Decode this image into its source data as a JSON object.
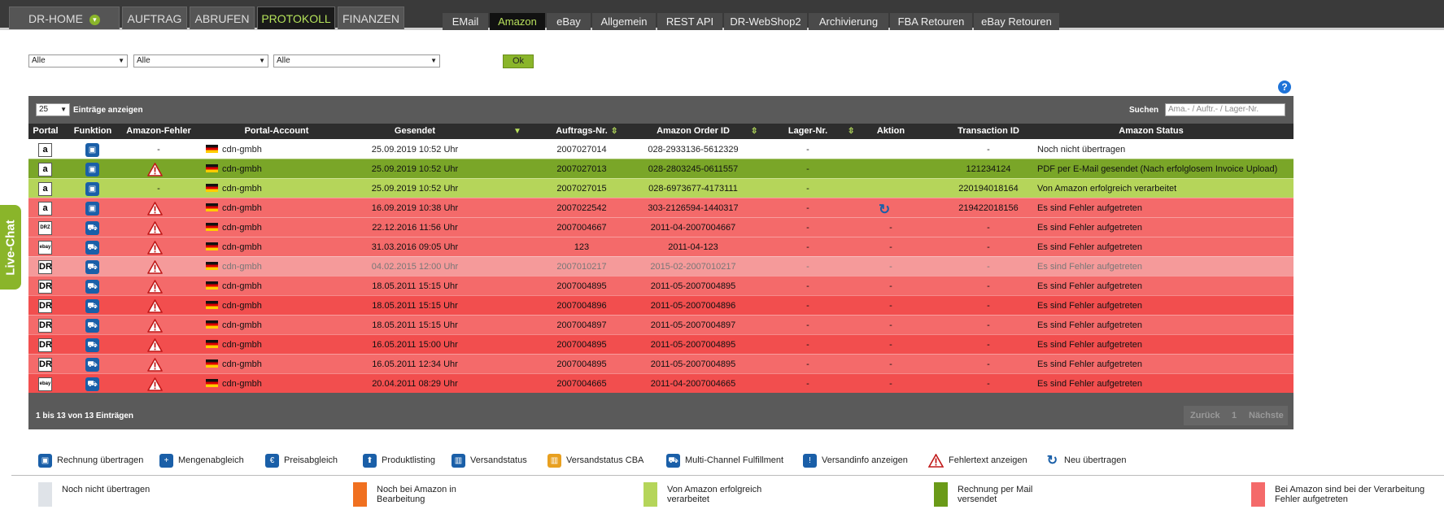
{
  "main_tabs": [
    {
      "label": "DR-HOME",
      "active": false
    },
    {
      "label": "AUFTRAG",
      "active": false
    },
    {
      "label": "ABRUFEN",
      "active": false
    },
    {
      "label": "PROTOKOLL",
      "active": true
    },
    {
      "label": "FINANZEN",
      "active": false
    }
  ],
  "sub_tabs": [
    {
      "label": "EMail",
      "active": false
    },
    {
      "label": "Amazon",
      "active": true
    },
    {
      "label": "eBay",
      "active": false
    },
    {
      "label": "Allgemein",
      "active": false
    },
    {
      "label": "REST API",
      "active": false
    },
    {
      "label": "DR-WebShop2",
      "active": false
    },
    {
      "label": "Archivierung",
      "active": false
    },
    {
      "label": "FBA Retouren",
      "active": false
    },
    {
      "label": "eBay Retouren",
      "active": false
    }
  ],
  "filters": {
    "select1": "Alle",
    "select2": "Alle",
    "select3": "Alle",
    "ok_label": "Ok"
  },
  "help_icon": "question-icon",
  "table": {
    "length_value": "25",
    "length_label": "Einträge anzeigen",
    "search_label": "Suchen",
    "search_placeholder": "Ama.- / Auftr.- / Lager-Nr.",
    "headers": [
      "Portal",
      "Funktion",
      "Amazon-Fehler",
      "Portal-Account",
      "Gesendet",
      "Auftrags-Nr.",
      "Amazon Order ID",
      "Lager-Nr.",
      "Aktion",
      "Transaction ID",
      "Amazon Status"
    ],
    "rows": [
      {
        "portal": "a",
        "portal_icon": "amazon-icon",
        "function_icon": "invoice-icon",
        "error": "-",
        "error_icon": false,
        "account": "cdn-gmbh",
        "sent": "25.09.2019 10:52 Uhr",
        "order_no": "2007027014",
        "amazon_order_id": "028-2933136-5612329",
        "storage_no": "-",
        "action": "",
        "action_icon": false,
        "transaction_id": "-",
        "status": "Noch nicht übertragen",
        "color": "#ffffff",
        "text_color": "#222"
      },
      {
        "portal": "a",
        "portal_icon": "amazon-icon",
        "function_icon": "invoice-icon",
        "error": "",
        "error_icon": true,
        "account": "cdn-gmbh",
        "sent": "25.09.2019 10:52 Uhr",
        "order_no": "2007027013",
        "amazon_order_id": "028-2803245-0611557",
        "storage_no": "-",
        "action": "",
        "action_icon": false,
        "transaction_id": "121234124",
        "status": "PDF per E-Mail gesendet (Nach erfolglosem Invoice Upload)",
        "color": "#7aa628",
        "text_color": "#111"
      },
      {
        "portal": "a",
        "portal_icon": "amazon-icon",
        "function_icon": "invoice-icon",
        "error": "-",
        "error_icon": false,
        "account": "cdn-gmbh",
        "sent": "25.09.2019 10:52 Uhr",
        "order_no": "2007027015",
        "amazon_order_id": "028-6973677-4173111",
        "storage_no": "-",
        "action": "",
        "action_icon": false,
        "transaction_id": "220194018164",
        "status": "Von Amazon erfolgreich verarbeitet",
        "color": "#b5d55a",
        "text_color": "#111"
      },
      {
        "portal": "a",
        "portal_icon": "amazon-icon",
        "function_icon": "invoice-icon",
        "error": "",
        "error_icon": true,
        "account": "cdn-gmbh",
        "sent": "16.09.2019 10:38 Uhr",
        "order_no": "2007022542",
        "amazon_order_id": "303-2126594-1440317",
        "storage_no": "-",
        "action": "",
        "action_icon": true,
        "transaction_id": "219422018156",
        "status": "Es sind Fehler aufgetreten",
        "color": "#f46a6a",
        "text_color": "#111"
      },
      {
        "portal": "DRZ",
        "portal_icon": "drz-icon",
        "function_icon": "truck-icon",
        "error": "",
        "error_icon": true,
        "account": "cdn-gmbh",
        "sent": "22.12.2016 11:56 Uhr",
        "order_no": "2007004667",
        "amazon_order_id": "2011-04-2007004667",
        "storage_no": "-",
        "action": "-",
        "action_icon": false,
        "transaction_id": "-",
        "status": "Es sind Fehler aufgetreten",
        "color": "#f46a6a",
        "text_color": "#111"
      },
      {
        "portal": "ebay",
        "portal_icon": "ebay-icon",
        "function_icon": "truck-icon",
        "error": "",
        "error_icon": true,
        "account": "cdn-gmbh",
        "sent": "31.03.2016 09:05 Uhr",
        "order_no": "123",
        "amazon_order_id": "2011-04-123",
        "storage_no": "-",
        "action": "-",
        "action_icon": false,
        "transaction_id": "-",
        "status": "Es sind Fehler aufgetreten",
        "color": "#f46a6a",
        "text_color": "#111"
      },
      {
        "portal": "DR",
        "portal_icon": "dr-icon",
        "function_icon": "truck-icon",
        "error": "",
        "error_icon": true,
        "account": "cdn-gmbh",
        "sent": "04.02.2015 12:00 Uhr",
        "order_no": "2007010217",
        "amazon_order_id": "2015-02-2007010217",
        "storage_no": "-",
        "action": "-",
        "action_icon": false,
        "transaction_id": "-",
        "status": "Es sind Fehler aufgetreten",
        "color": "#f59a9a",
        "text_color": "#777"
      },
      {
        "portal": "DR",
        "portal_icon": "dr-icon",
        "function_icon": "truck-icon",
        "error": "",
        "error_icon": true,
        "account": "cdn-gmbh",
        "sent": "18.05.2011 15:15 Uhr",
        "order_no": "2007004895",
        "amazon_order_id": "2011-05-2007004895",
        "storage_no": "-",
        "action": "-",
        "action_icon": false,
        "transaction_id": "-",
        "status": "Es sind Fehler aufgetreten",
        "color": "#f46a6a",
        "text_color": "#111"
      },
      {
        "portal": "DR",
        "portal_icon": "dr-icon",
        "function_icon": "truck-icon",
        "error": "",
        "error_icon": true,
        "account": "cdn-gmbh",
        "sent": "18.05.2011 15:15 Uhr",
        "order_no": "2007004896",
        "amazon_order_id": "2011-05-2007004896",
        "storage_no": "-",
        "action": "-",
        "action_icon": false,
        "transaction_id": "-",
        "status": "Es sind Fehler aufgetreten",
        "color": "#f24e4e",
        "text_color": "#111"
      },
      {
        "portal": "DR",
        "portal_icon": "dr-icon",
        "function_icon": "truck-icon",
        "error": "",
        "error_icon": true,
        "account": "cdn-gmbh",
        "sent": "18.05.2011 15:15 Uhr",
        "order_no": "2007004897",
        "amazon_order_id": "2011-05-2007004897",
        "storage_no": "-",
        "action": "-",
        "action_icon": false,
        "transaction_id": "-",
        "status": "Es sind Fehler aufgetreten",
        "color": "#f46a6a",
        "text_color": "#111"
      },
      {
        "portal": "DR",
        "portal_icon": "dr-icon",
        "function_icon": "truck-icon",
        "error": "",
        "error_icon": true,
        "account": "cdn-gmbh",
        "sent": "16.05.2011 15:00 Uhr",
        "order_no": "2007004895",
        "amazon_order_id": "2011-05-2007004895",
        "storage_no": "-",
        "action": "-",
        "action_icon": false,
        "transaction_id": "-",
        "status": "Es sind Fehler aufgetreten",
        "color": "#f24e4e",
        "text_color": "#111"
      },
      {
        "portal": "DR",
        "portal_icon": "dr-icon",
        "function_icon": "truck-icon",
        "error": "",
        "error_icon": true,
        "account": "cdn-gmbh",
        "sent": "16.05.2011 12:34 Uhr",
        "order_no": "2007004895",
        "amazon_order_id": "2011-05-2007004895",
        "storage_no": "-",
        "action": "-",
        "action_icon": false,
        "transaction_id": "-",
        "status": "Es sind Fehler aufgetreten",
        "color": "#f46a6a",
        "text_color": "#111"
      },
      {
        "portal": "ebay",
        "portal_icon": "ebay-icon",
        "function_icon": "truck-icon",
        "error": "",
        "error_icon": true,
        "account": "cdn-gmbh",
        "sent": "20.04.2011 08:29 Uhr",
        "order_no": "2007004665",
        "amazon_order_id": "2011-04-2007004665",
        "storage_no": "-",
        "action": "-",
        "action_icon": false,
        "transaction_id": "-",
        "status": "Es sind Fehler aufgetreten",
        "color": "#f24e4e",
        "text_color": "#111"
      }
    ],
    "info": "1 bis 13 von 13 Einträgen",
    "pager": {
      "prev": "Zurück",
      "page": "1",
      "next": "Nächste"
    }
  },
  "legend_icons": [
    {
      "label": "Rechnung übertragen",
      "icon": "invoice-icon",
      "glyph": "▣",
      "color": "#1a5fa8"
    },
    {
      "label": "Mengenabgleich",
      "icon": "plus-icon",
      "glyph": "+",
      "color": "#1a5fa8"
    },
    {
      "label": "Preisabgleich",
      "icon": "euro-icon",
      "glyph": "€",
      "color": "#1a5fa8"
    },
    {
      "label": "Produktlisting",
      "icon": "upload-icon",
      "glyph": "⬆",
      "color": "#1a5fa8"
    },
    {
      "label": "Versandstatus",
      "icon": "box-icon",
      "glyph": "▥",
      "color": "#1a5fa8"
    },
    {
      "label": "Versandstatus CBA",
      "icon": "box-cba-icon",
      "glyph": "▥",
      "color": "#e8a020"
    },
    {
      "label": "Multi-Channel Fulfillment",
      "icon": "truck-icon",
      "glyph": "⛟",
      "color": "#1a5fa8"
    },
    {
      "label": "Versandinfo anzeigen",
      "icon": "info-icon",
      "glyph": "!",
      "color": "#1a5fa8"
    },
    {
      "label": "Fehlertext anzeigen",
      "icon": "warning-icon",
      "glyph": "!",
      "color": "#d02020"
    },
    {
      "label": "Neu übertragen",
      "icon": "refresh-icon",
      "glyph": "↻",
      "color": "#1a5fa8"
    }
  ],
  "legend_status": [
    {
      "label": "Noch nicht übertragen",
      "color": "#dfe3e8"
    },
    {
      "label": "Noch bei Amazon in Bearbeitung",
      "color": "#f07020"
    },
    {
      "label": "Von Amazon erfolgreich verarbeitet",
      "color": "#b5d55a"
    },
    {
      "label": "Rechnung per Mail versendet",
      "color": "#6a9a18"
    },
    {
      "label": "Bei Amazon sind bei der Verarbeitung Fehler aufgetreten",
      "color": "#f46a6a"
    }
  ],
  "live_chat": "Live-Chat"
}
